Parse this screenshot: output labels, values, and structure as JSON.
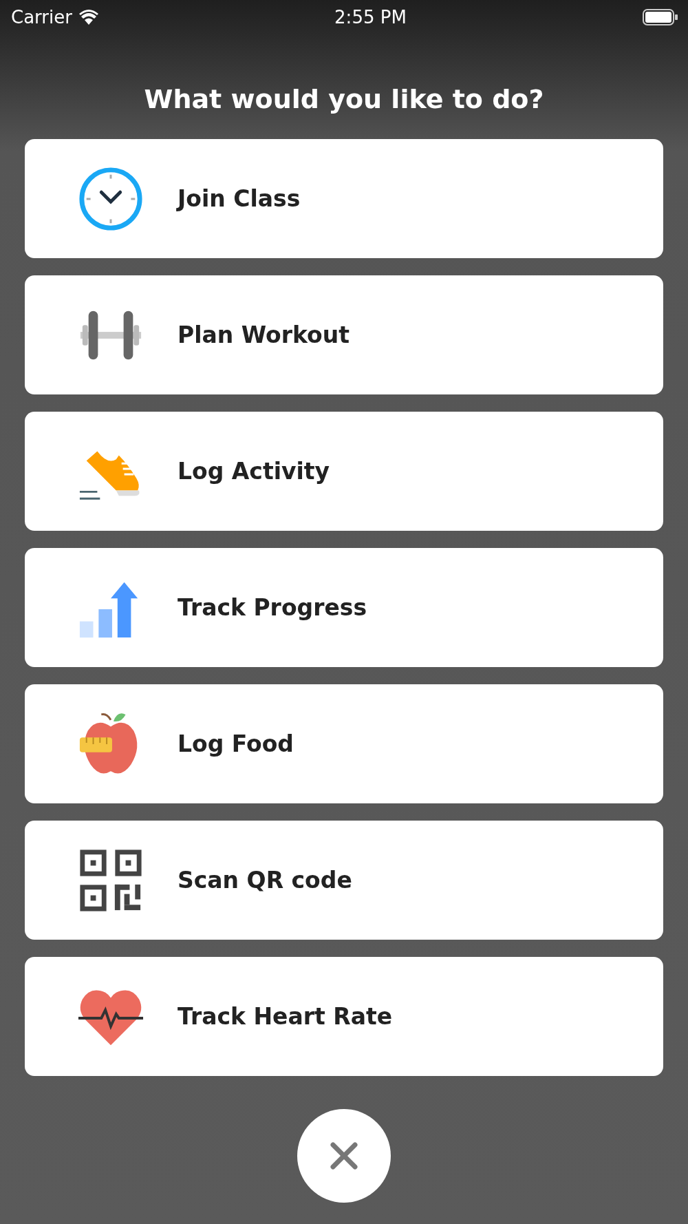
{
  "status_bar": {
    "carrier": "Carrier",
    "time": "2:55 PM"
  },
  "title": "What would you like to do?",
  "actions": [
    {
      "label": "Join Class",
      "kind": "clock"
    },
    {
      "label": "Plan Workout",
      "kind": "dumbbell"
    },
    {
      "label": "Log Activity",
      "kind": "shoe"
    },
    {
      "label": "Track Progress",
      "kind": "chart"
    },
    {
      "label": "Log Food",
      "kind": "apple"
    },
    {
      "label": "Scan QR code",
      "kind": "qr"
    },
    {
      "label": "Track Heart Rate",
      "kind": "heart"
    }
  ]
}
